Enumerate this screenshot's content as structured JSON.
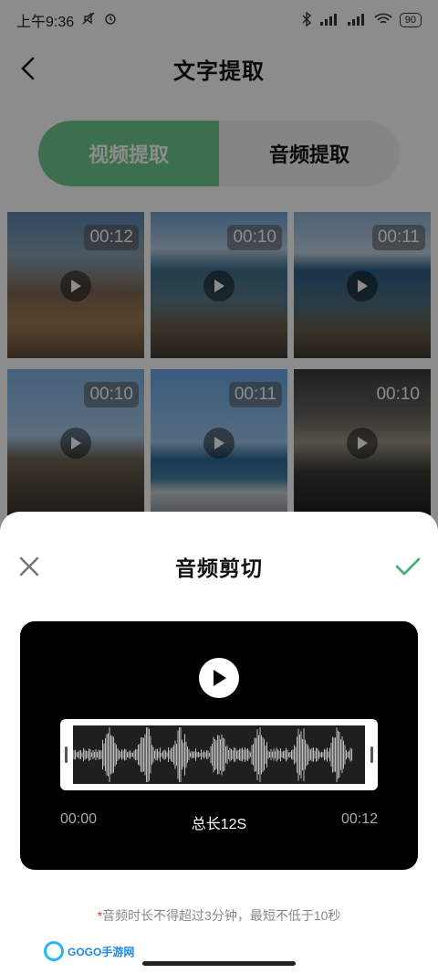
{
  "status_bar": {
    "time": "上午9:36",
    "battery": "90"
  },
  "nav": {
    "title": "文字提取"
  },
  "segment": {
    "video_tab": "视频提取",
    "audio_tab": "音频提取"
  },
  "videos": [
    {
      "duration": "00:12"
    },
    {
      "duration": "00:10"
    },
    {
      "duration": "00:11"
    },
    {
      "duration": "00:10"
    },
    {
      "duration": "00:11"
    },
    {
      "duration": "00:10"
    }
  ],
  "sheet": {
    "title": "音频剪切",
    "start_time": "00:00",
    "total": "总长12S",
    "end_time": "00:12",
    "notice_star": "*",
    "notice": "音频时长不得超过3分钟，最短不低于10秒"
  },
  "watermark": {
    "text": "GOGO手游网"
  },
  "colors": {
    "accent": "#6ecb8c",
    "confirm": "#4caf7a",
    "player_bg": "#000000"
  }
}
